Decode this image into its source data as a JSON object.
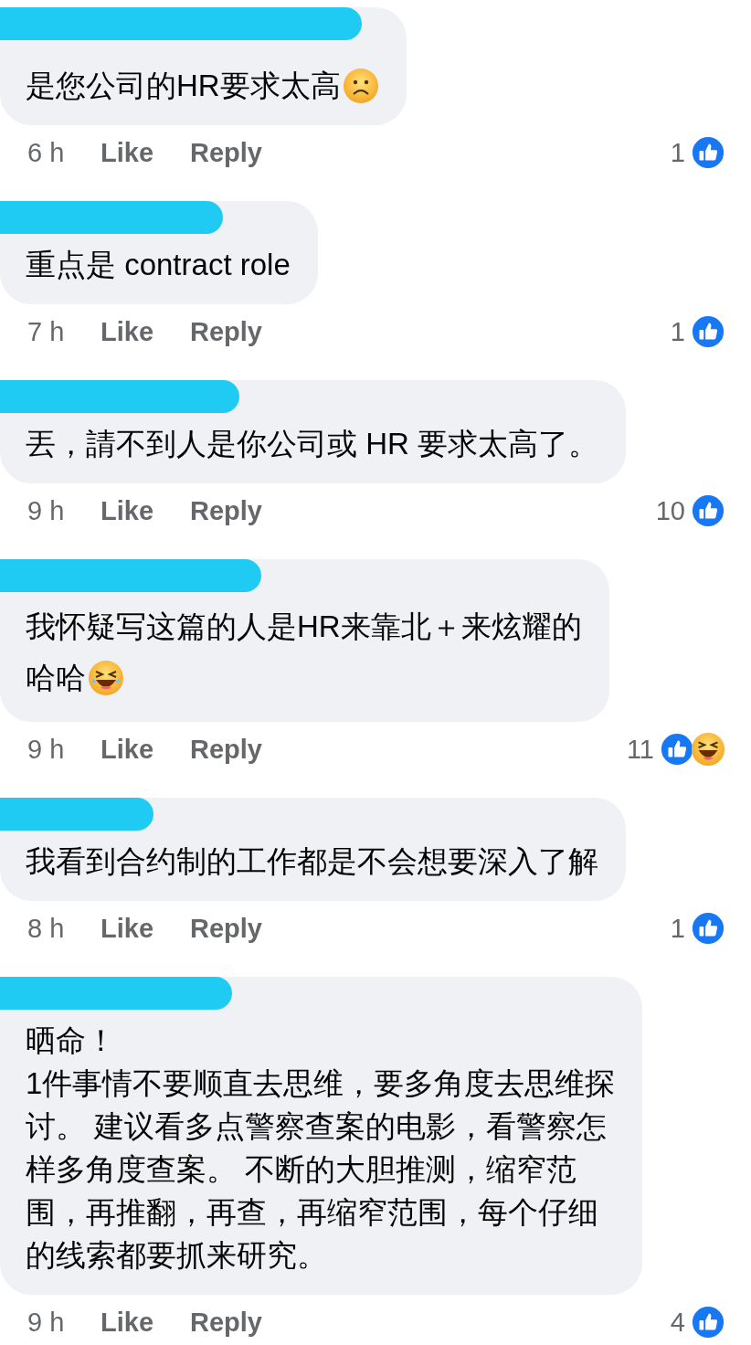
{
  "comments": [
    {
      "lines": [
        "是您公司的HR要求太高"
      ],
      "emoji": {
        "kind": "frown"
      },
      "time": "6 h",
      "like": "Like",
      "reply": "Reply",
      "count": "1",
      "reactions": [
        {
          "kind": "like"
        }
      ]
    },
    {
      "lines": [
        "重点是 contract role"
      ],
      "time": "7 h",
      "like": "Like",
      "reply": "Reply",
      "count": "1",
      "reactions": [
        {
          "kind": "like"
        }
      ]
    },
    {
      "lines": [
        "丟，請不到人是你公司或 HR 要求太高了。"
      ],
      "time": "9 h",
      "like": "Like",
      "reply": "Reply",
      "count": "10",
      "reactions": [
        {
          "kind": "like"
        }
      ]
    },
    {
      "lines": [
        "我怀疑写这篇的人是HR来靠北＋来炫耀的",
        "哈哈"
      ],
      "emoji": {
        "kind": "laugh"
      },
      "time": "9 h",
      "like": "Like",
      "reply": "Reply",
      "count": "11",
      "reactions": [
        {
          "kind": "like"
        },
        {
          "kind": "haha"
        }
      ]
    },
    {
      "lines": [
        "我看到合约制的工作都是不会想要深入了解"
      ],
      "time": "8 h",
      "like": "Like",
      "reply": "Reply",
      "count": "1",
      "reactions": [
        {
          "kind": "like"
        }
      ]
    },
    {
      "lines": [
        "晒命！",
        "1件事情不要顺直去思维，要多角度去思维探",
        "讨。 建议看多点警察查案的电影，看警察怎",
        "样多角度查案。 不断的大胆推测，缩窄范",
        "围，再推翻，再查，再缩窄范围，每个仔细",
        "的线索都要抓来研究。"
      ],
      "time": "9 h",
      "like": "Like",
      "reply": "Reply",
      "count": "4",
      "reactions": [
        {
          "kind": "like"
        }
      ]
    }
  ]
}
